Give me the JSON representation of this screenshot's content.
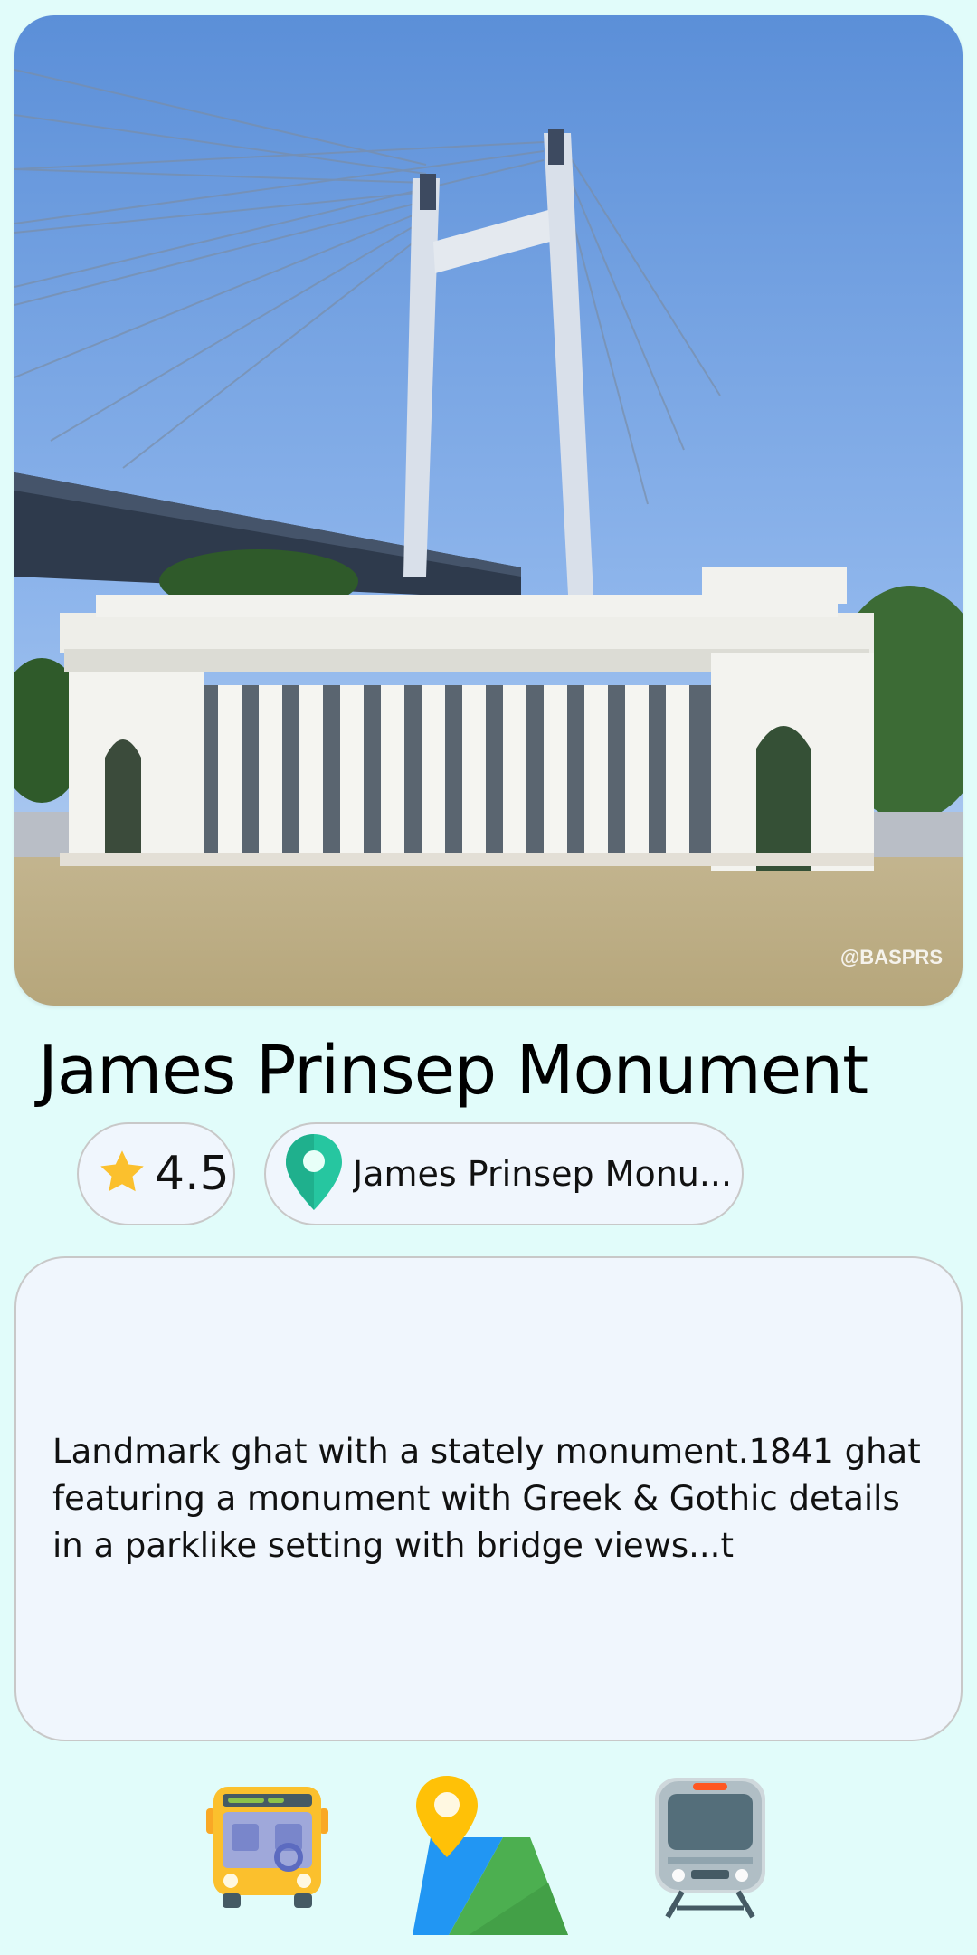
{
  "place": {
    "title": "James Prinsep Monument",
    "rating": "4.5",
    "location_label": "James Prinsep Monu...",
    "description": "Landmark ghat with a stately monument.1841 ghat featuring a monument with Greek & Gothic details in a parklike setting with bridge views...t",
    "photo_watermark": "@BASPRS"
  },
  "icons": {
    "rating": "star-icon",
    "location": "map-pin-icon",
    "bus": "bus-icon",
    "map": "map-icon",
    "train": "train-icon"
  },
  "colors": {
    "background": "#e1fcfa",
    "card": "#f0f6fd",
    "border": "#c8c8c8",
    "star": "#fbc02d",
    "pin": "#26c6a0"
  }
}
